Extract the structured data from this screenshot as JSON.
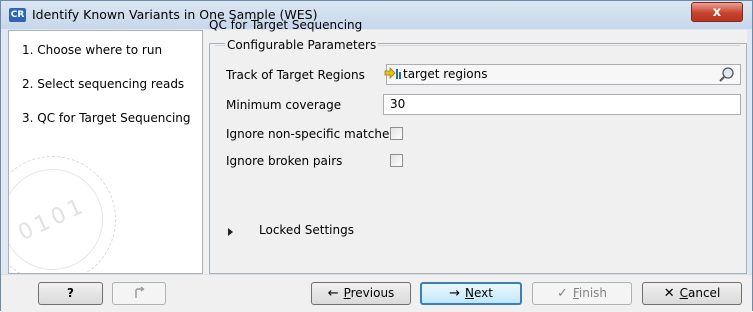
{
  "window": {
    "title": "Identify Known Variants in One Sample (WES)",
    "app_icon_text": "CR",
    "close_label": "x"
  },
  "steps": [
    {
      "label": "1.  Choose where to run"
    },
    {
      "label": "2.  Select sequencing reads"
    },
    {
      "label": "3.  QC for Target Sequencing"
    }
  ],
  "main": {
    "header": "QC for Target Sequencing",
    "group_title": "Configurable Parameters",
    "fields": {
      "track_label": "Track of Target Regions",
      "track_value": "target regions",
      "min_coverage_label": "Minimum coverage",
      "min_coverage_value": "30",
      "ignore_nonspecific_label": "Ignore non-specific matches",
      "ignore_nonspecific_checked": false,
      "ignore_broken_label": "Ignore broken pairs",
      "ignore_broken_checked": false
    },
    "locked_settings": "Locked Settings"
  },
  "buttons": {
    "help": "?",
    "previous_rest": "revious",
    "previous_key": "P",
    "next_rest": "ext",
    "next_key": "N",
    "finish_rest": "inish",
    "finish_key": "F",
    "cancel_rest": "ancel",
    "cancel_key": "C"
  },
  "icons": {
    "app": "app-icon",
    "close": "close-icon",
    "track": "track-icon",
    "browse": "browse-icon",
    "reset": "reset-icon",
    "previous": "arrow-left-icon",
    "next": "arrow-right-icon",
    "finish": "checkmark-icon",
    "cancel": "x-icon"
  },
  "colors": {
    "close_button": "#c8442e",
    "default_button_border": "#3c7fb1",
    "title_bar": "#c7d7ea"
  }
}
